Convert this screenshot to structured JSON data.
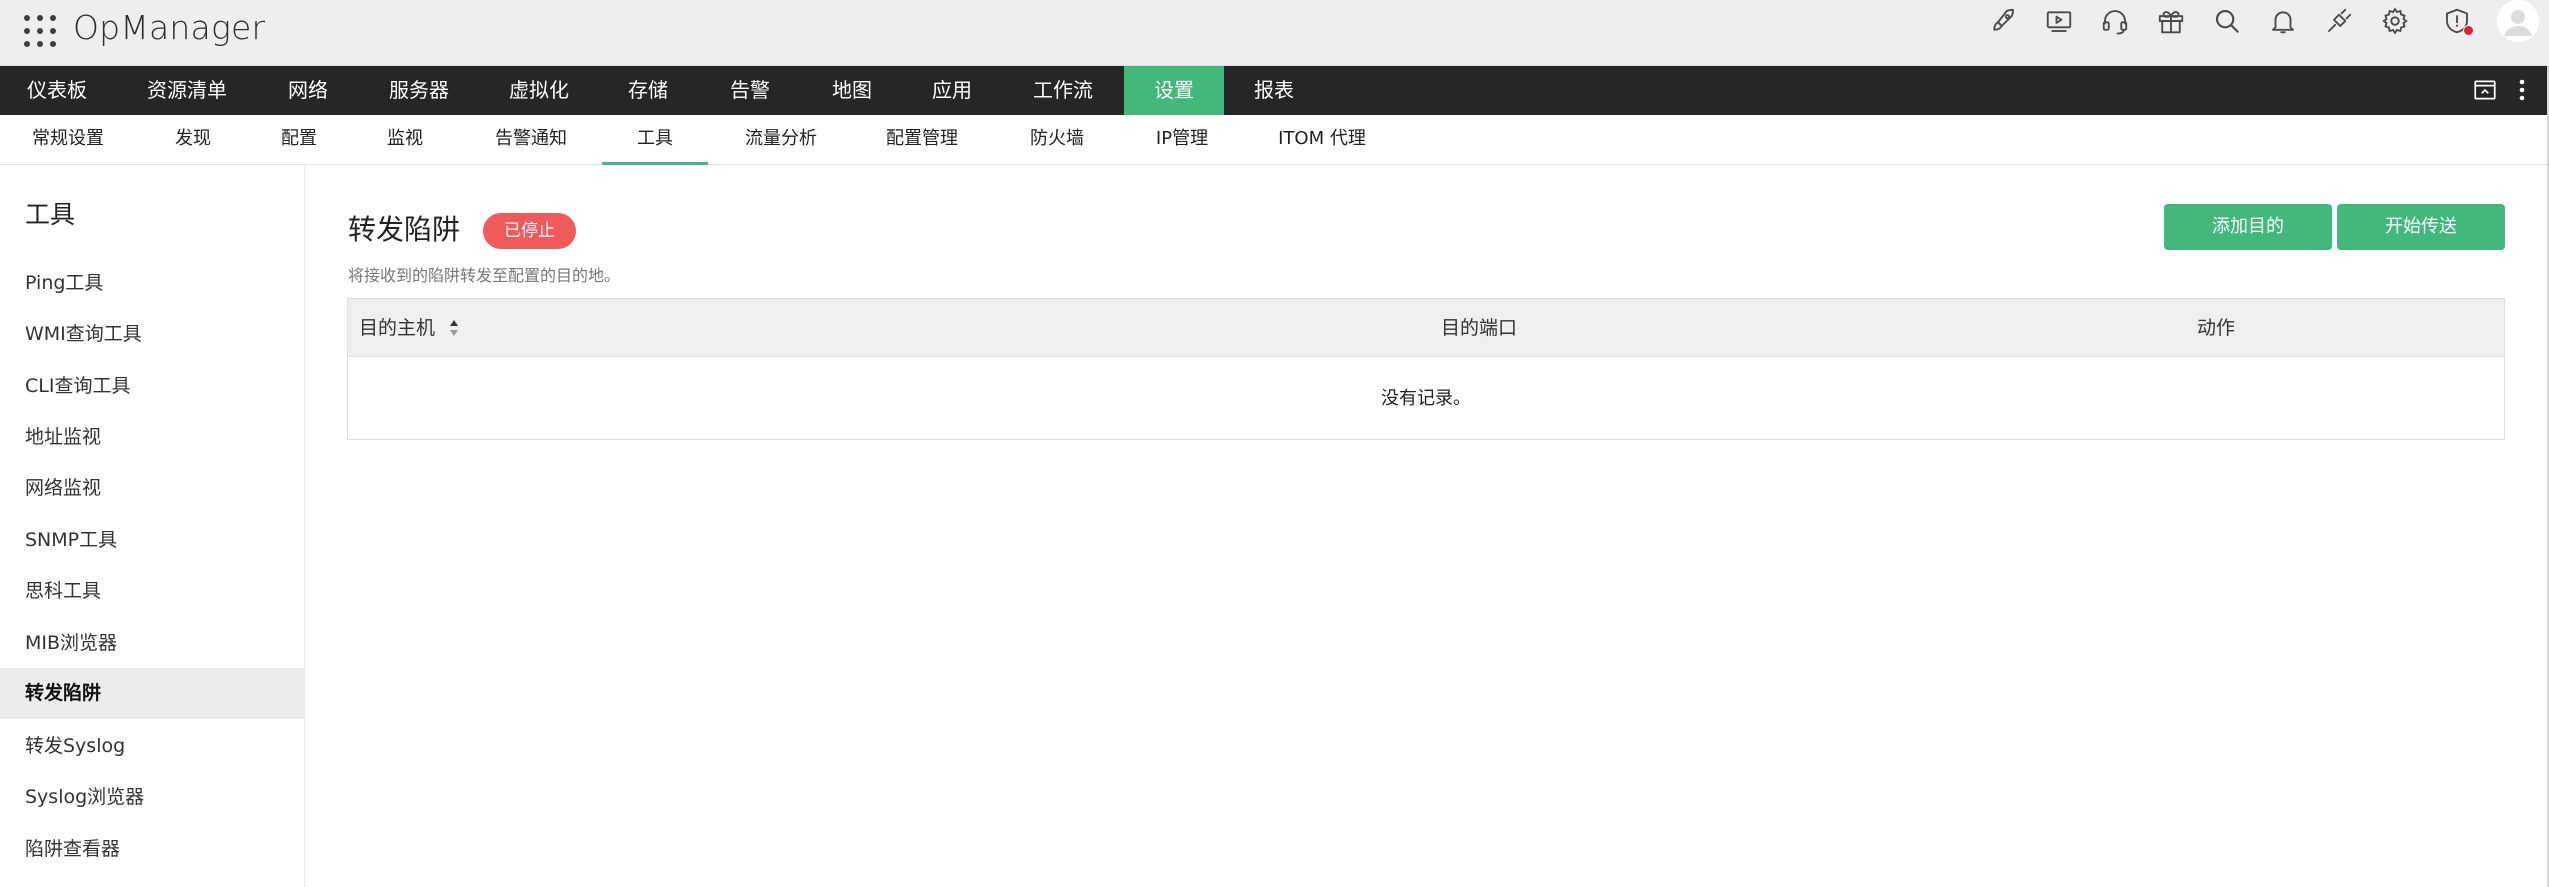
{
  "header": {
    "app_name": "OpManager",
    "icons": [
      "rocket-icon",
      "video-icon",
      "headset-icon",
      "gift-icon",
      "search-icon",
      "bell-icon",
      "plug-icon",
      "gear-icon",
      "shield-alert-icon",
      "avatar"
    ]
  },
  "main_nav": {
    "items": [
      "仪表板",
      "资源清单",
      "网络",
      "服务器",
      "虚拟化",
      "存储",
      "告警",
      "地图",
      "应用",
      "工作流",
      "设置",
      "报表"
    ],
    "active": "设置"
  },
  "sub_nav": {
    "items": [
      "常规设置",
      "发现",
      "配置",
      "监视",
      "告警通知",
      "工具",
      "流量分析",
      "配置管理",
      "防火墙",
      "IP管理",
      "ITOM 代理"
    ],
    "active": "工具"
  },
  "sidebar": {
    "title": "工具",
    "items": [
      "Ping工具",
      "WMI查询工具",
      "CLI查询工具",
      "地址监视",
      "网络监视",
      "SNMP工具",
      "思科工具",
      "MIB浏览器",
      "转发陷阱",
      "转发Syslog",
      "Syslog浏览器",
      "陷阱查看器"
    ],
    "active": "转发陷阱"
  },
  "content": {
    "title": "转发陷阱",
    "status": "已停止",
    "description": "将接收到的陷阱转发至配置的目的地。",
    "buttons": {
      "add_destination": "添加目的",
      "start_forwarding": "开始传送"
    },
    "table": {
      "columns": [
        "目的主机",
        "目的端口",
        "动作"
      ],
      "empty_message": "没有记录。"
    }
  },
  "colors": {
    "accent": "#43b87c",
    "nav_bg": "#262626",
    "badge_stopped": "#f05a5b",
    "header_bg": "#eeeeef"
  }
}
